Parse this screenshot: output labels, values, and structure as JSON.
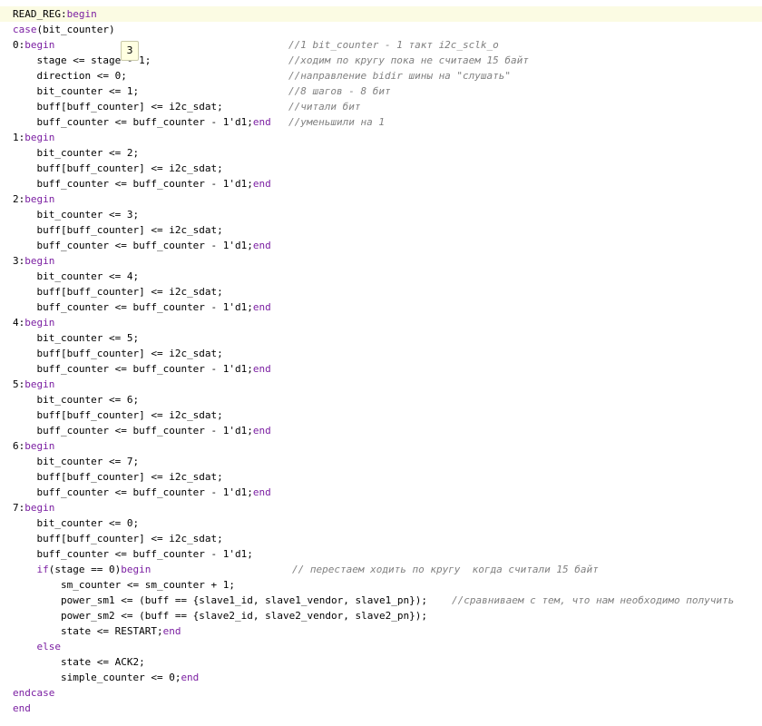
{
  "colors": {
    "keyword": "#7b1fa2",
    "comment": "#808080",
    "current_line_bg": "#fbfbe3",
    "tooltip_bg": "#ffffe1"
  },
  "tooltip": {
    "text": "3"
  },
  "lines": [
    {
      "indent": 0,
      "parts": [
        {
          "t": "READ_REG:"
        },
        {
          "t": "begin",
          "k": "kw"
        }
      ],
      "current": true
    },
    {
      "indent": 0,
      "parts": [
        {
          "t": "case",
          "k": "kw"
        },
        {
          "t": "(bit_counter)"
        }
      ]
    },
    {
      "indent": 0,
      "parts": [
        {
          "t": "0:"
        },
        {
          "t": "begin",
          "k": "kw"
        }
      ],
      "comment": "//1 bit_counter - 1 такт i2c_sclk_o",
      "ccol": 318
    },
    {
      "indent": 4,
      "parts": [
        {
          "t": "stage <= stage - 1;"
        }
      ],
      "comment": "//ходим по кругу пока не считаем 15 байт",
      "ccol": 318
    },
    {
      "indent": 4,
      "parts": [
        {
          "t": "direction <= 0;"
        }
      ],
      "comment": "//направление bidir шины на \"слушать\"",
      "ccol": 318
    },
    {
      "indent": 4,
      "parts": [
        {
          "t": "bit_counter <= 1;"
        }
      ],
      "comment": "//8 шагов - 8 бит",
      "ccol": 318
    },
    {
      "indent": 4,
      "parts": [
        {
          "t": "buff[buff_counter] <= i2c_sdat;"
        }
      ],
      "comment": "//читали бит",
      "ccol": 318
    },
    {
      "indent": 4,
      "parts": [
        {
          "t": "buff_counter <= buff_counter - 1'd1;"
        },
        {
          "t": "end",
          "k": "kw"
        }
      ],
      "comment": "//уменьшили на 1",
      "ccol": 318
    },
    {
      "indent": 0,
      "parts": [
        {
          "t": "1:"
        },
        {
          "t": "begin",
          "k": "kw"
        }
      ]
    },
    {
      "indent": 4,
      "parts": [
        {
          "t": "bit_counter <= 2;"
        }
      ]
    },
    {
      "indent": 4,
      "parts": [
        {
          "t": "buff[buff_counter] <= i2c_sdat;"
        }
      ]
    },
    {
      "indent": 4,
      "parts": [
        {
          "t": "buff_counter <= buff_counter - 1'd1;"
        },
        {
          "t": "end",
          "k": "kw"
        }
      ]
    },
    {
      "indent": 0,
      "parts": [
        {
          "t": "2:"
        },
        {
          "t": "begin",
          "k": "kw"
        }
      ]
    },
    {
      "indent": 4,
      "parts": [
        {
          "t": "bit_counter <= 3;"
        }
      ]
    },
    {
      "indent": 4,
      "parts": [
        {
          "t": "buff[buff_counter] <= i2c_sdat;"
        }
      ]
    },
    {
      "indent": 4,
      "parts": [
        {
          "t": "buff_counter <= buff_counter - 1'd1;"
        },
        {
          "t": "end",
          "k": "kw"
        }
      ]
    },
    {
      "indent": 0,
      "parts": [
        {
          "t": "3:"
        },
        {
          "t": "begin",
          "k": "kw"
        }
      ]
    },
    {
      "indent": 4,
      "parts": [
        {
          "t": "bit_counter <= 4;"
        }
      ]
    },
    {
      "indent": 4,
      "parts": [
        {
          "t": "buff[buff_counter] <= i2c_sdat;"
        }
      ]
    },
    {
      "indent": 4,
      "parts": [
        {
          "t": "buff_counter <= buff_counter - 1'd1;"
        },
        {
          "t": "end",
          "k": "kw"
        }
      ]
    },
    {
      "indent": 0,
      "parts": [
        {
          "t": "4:"
        },
        {
          "t": "begin",
          "k": "kw"
        }
      ]
    },
    {
      "indent": 4,
      "parts": [
        {
          "t": "bit_counter <= 5;"
        }
      ]
    },
    {
      "indent": 4,
      "parts": [
        {
          "t": "buff[buff_counter] <= i2c_sdat;"
        }
      ]
    },
    {
      "indent": 4,
      "parts": [
        {
          "t": "buff_counter <= buff_counter - 1'd1;"
        },
        {
          "t": "end",
          "k": "kw"
        }
      ]
    },
    {
      "indent": 0,
      "parts": [
        {
          "t": "5:"
        },
        {
          "t": "begin",
          "k": "kw"
        }
      ]
    },
    {
      "indent": 4,
      "parts": [
        {
          "t": "bit_counter <= 6;"
        }
      ]
    },
    {
      "indent": 4,
      "parts": [
        {
          "t": "buff[buff_counter] <= i2c_sdat;"
        }
      ]
    },
    {
      "indent": 4,
      "parts": [
        {
          "t": "buff_counter <= buff_counter - 1'd1;"
        },
        {
          "t": "end",
          "k": "kw"
        }
      ]
    },
    {
      "indent": 0,
      "parts": [
        {
          "t": "6:"
        },
        {
          "t": "begin",
          "k": "kw"
        }
      ]
    },
    {
      "indent": 4,
      "parts": [
        {
          "t": "bit_counter <= 7;"
        }
      ]
    },
    {
      "indent": 4,
      "parts": [
        {
          "t": "buff[buff_counter] <= i2c_sdat;"
        }
      ]
    },
    {
      "indent": 4,
      "parts": [
        {
          "t": "buff_counter <= buff_counter - 1'd1;"
        },
        {
          "t": "end",
          "k": "kw"
        }
      ]
    },
    {
      "indent": 0,
      "parts": [
        {
          "t": "7:"
        },
        {
          "t": "begin",
          "k": "kw"
        }
      ]
    },
    {
      "indent": 4,
      "parts": [
        {
          "t": "bit_counter <= 0;"
        }
      ]
    },
    {
      "indent": 4,
      "parts": [
        {
          "t": "buff[buff_counter] <= i2c_sdat;"
        }
      ]
    },
    {
      "indent": 4,
      "parts": [
        {
          "t": "buff_counter <= buff_counter - 1'd1;"
        }
      ]
    },
    {
      "indent": 4,
      "parts": [
        {
          "t": "if",
          "k": "kw"
        },
        {
          "t": "(stage == 0)"
        },
        {
          "t": "begin",
          "k": "kw"
        }
      ],
      "comment": "// перестаем ходить по кругу  когда считали 15 байт",
      "ccol": 322
    },
    {
      "indent": 8,
      "parts": [
        {
          "t": "sm_counter <= sm_counter + 1;"
        }
      ]
    },
    {
      "indent": 8,
      "parts": [
        {
          "t": "power_sm1 <= (buff == {slave1_id, slave1_vendor, slave1_pn});"
        }
      ],
      "comment": "//сравниваем с тем, что нам необходимо получить",
      "ccol": 498
    },
    {
      "indent": 8,
      "parts": [
        {
          "t": "power_sm2 <= (buff == {slave2_id, slave2_vendor, slave2_pn});"
        }
      ]
    },
    {
      "indent": 8,
      "parts": [
        {
          "t": "state <= RESTART;"
        },
        {
          "t": "end",
          "k": "kw"
        }
      ]
    },
    {
      "indent": 4,
      "parts": [
        {
          "t": "else",
          "k": "kw"
        }
      ]
    },
    {
      "indent": 8,
      "parts": [
        {
          "t": "state <= ACK2;"
        }
      ]
    },
    {
      "indent": 8,
      "parts": [
        {
          "t": "simple_counter <= 0;"
        },
        {
          "t": "end",
          "k": "kw"
        }
      ]
    },
    {
      "indent": 0,
      "parts": [
        {
          "t": "endcase",
          "k": "kw"
        }
      ]
    },
    {
      "indent": 0,
      "parts": [
        {
          "t": "end",
          "k": "kw"
        }
      ]
    }
  ]
}
